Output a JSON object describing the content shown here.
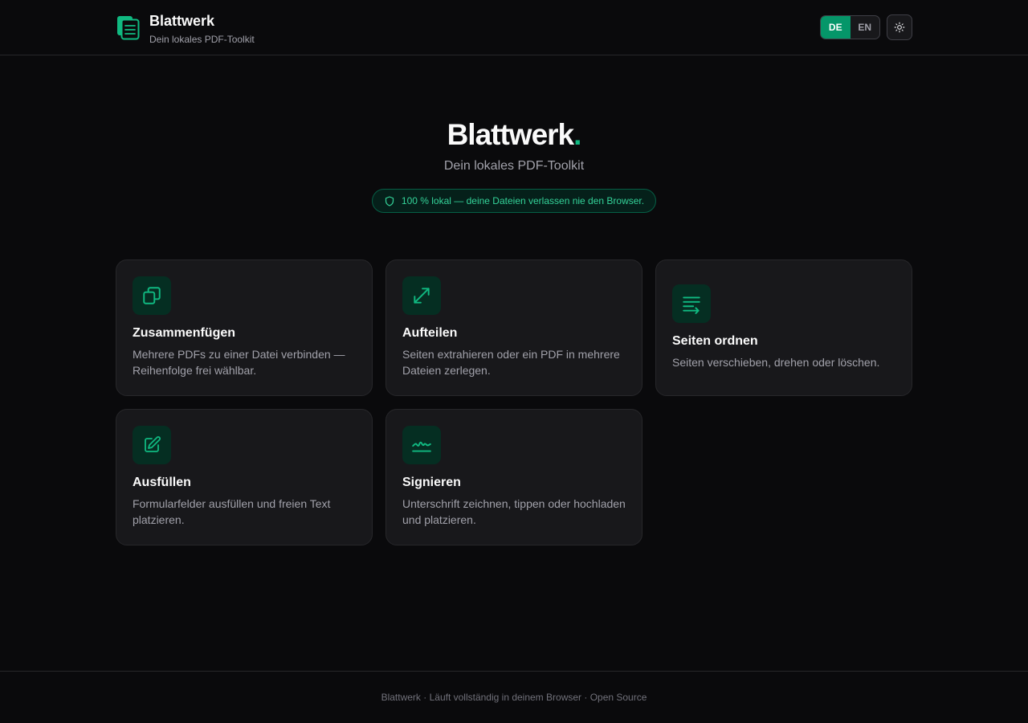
{
  "header": {
    "brand_name": "Blattwerk",
    "brand_tagline": "Dein lokales PDF-Toolkit",
    "lang_de": "DE",
    "lang_en": "EN",
    "active_lang": "DE"
  },
  "hero": {
    "title": "Blattwerk",
    "title_dot": ".",
    "subtitle": "Dein lokales PDF-Toolkit",
    "badge": "100 % lokal — deine Dateien verlassen nie den Browser."
  },
  "tools": [
    {
      "title": "Zusammenfügen",
      "description": "Mehrere PDFs zu einer Datei verbinden — Reihenfolge frei wählbar.",
      "icon": "merge-icon"
    },
    {
      "title": "Aufteilen",
      "description": "Seiten extrahieren oder ein PDF in mehrere Dateien zerlegen.",
      "icon": "split-icon"
    },
    {
      "title": "Seiten ordnen",
      "description": "Seiten verschieben, drehen oder löschen.",
      "icon": "reorder-icon"
    },
    {
      "title": "Ausfüllen",
      "description": "Formularfelder ausfüllen und freien Text platzieren.",
      "icon": "edit-icon"
    },
    {
      "title": "Signieren",
      "description": "Unterschrift zeichnen, tippen oder hochladen und platzieren.",
      "icon": "signature-icon"
    }
  ],
  "footer": {
    "text": "Blattwerk · Läuft vollständig in deinem Browser · Open Source"
  },
  "colors": {
    "accent": "#10b981",
    "background": "#0a0a0c",
    "card": "#18181b"
  }
}
